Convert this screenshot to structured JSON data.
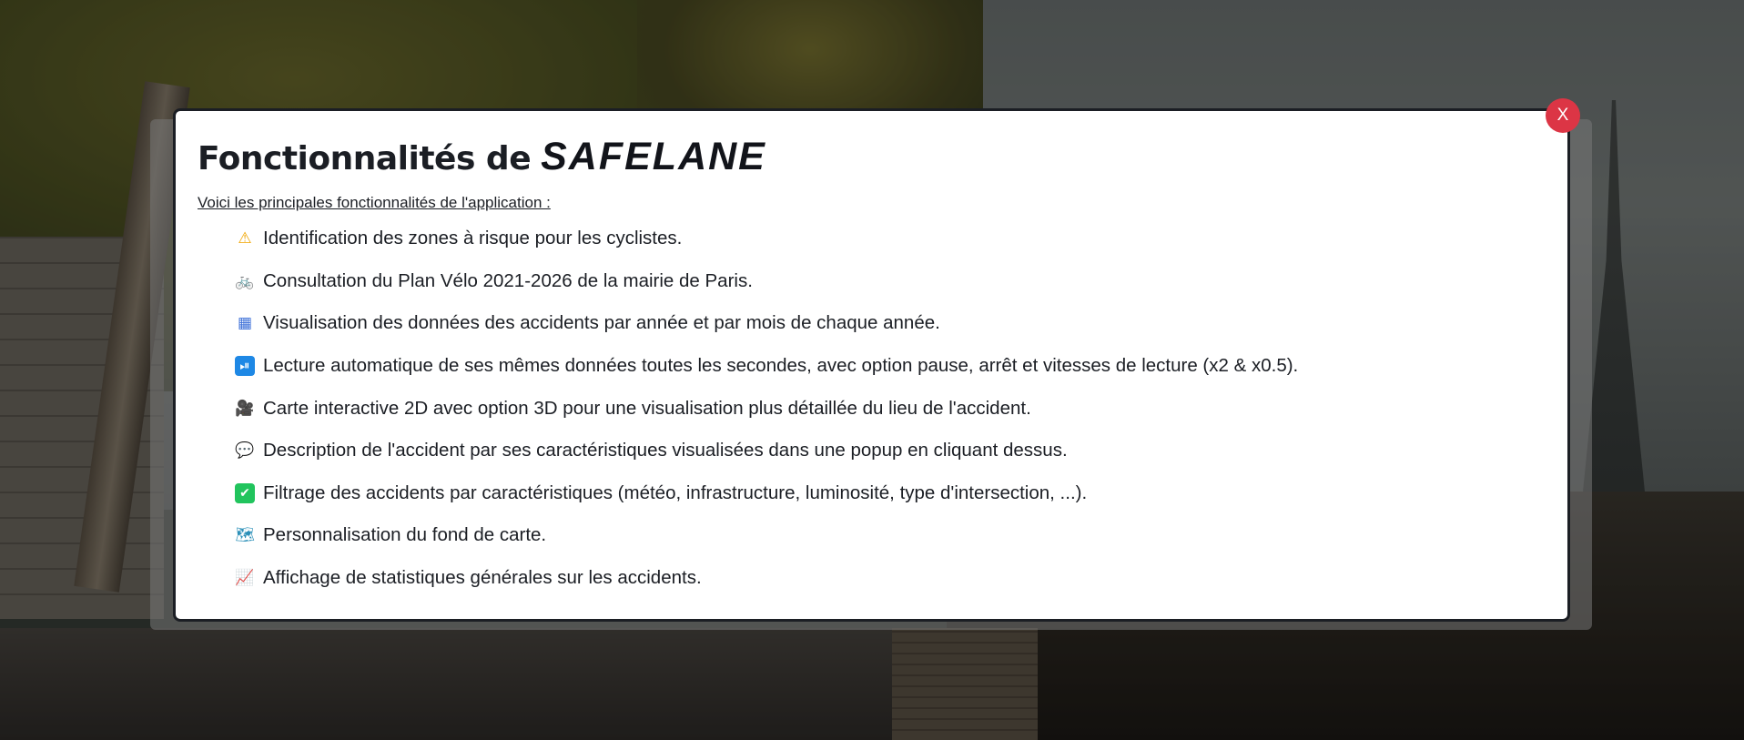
{
  "modal": {
    "title_prefix": "Fonctionnalités de",
    "brand": "SAFELANE",
    "intro": "Voici les principales fonctionnalités de l'application :",
    "close_label": "X",
    "features": [
      {
        "icon": "warning-icon",
        "glyph": "⚠",
        "color": "#f0a500",
        "text": "Identification des zones à risque pour les cyclistes."
      },
      {
        "icon": "bicycle-icon",
        "glyph": "🚲",
        "color": "#d94a6a",
        "text": "Consultation du Plan Vélo 2021-2026 de la mairie de Paris."
      },
      {
        "icon": "calendar-icon",
        "glyph": "▦",
        "color": "#3b6fd8",
        "text": "Visualisation des données des accidents par année et par mois de chaque année."
      },
      {
        "icon": "play-pause-icon",
        "glyph": "⏯",
        "color": "#1e88e5",
        "text": "Lecture automatique de ses mêmes données toutes les secondes, avec option pause, arrêt et vitesses de lecture (x2 & x0.5)."
      },
      {
        "icon": "movie-camera-icon",
        "glyph": "🎥",
        "color": "#5a4a8a",
        "text": "Carte interactive 2D avec option 3D pour une visualisation plus détaillée du lieu de l'accident."
      },
      {
        "icon": "speech-bubble-icon",
        "glyph": "💬",
        "color": "#9aa0a6",
        "text": "Description de l'accident par ses caractéristiques visualisées dans une popup en cliquant dessus."
      },
      {
        "icon": "check-box-icon",
        "glyph": "✔",
        "color": "#21c45d",
        "text": "Filtrage des accidents par caractéristiques (météo, infrastructure, luminosité, type d'intersection, ...)."
      },
      {
        "icon": "map-icon",
        "glyph": "🗺",
        "color": "#2a8fb8",
        "text": "Personnalisation du fond de carte."
      },
      {
        "icon": "chart-increasing-icon",
        "glyph": "📈",
        "color": "#e0457b",
        "text": "Affichage de statistiques générales sur les accidents."
      }
    ]
  }
}
